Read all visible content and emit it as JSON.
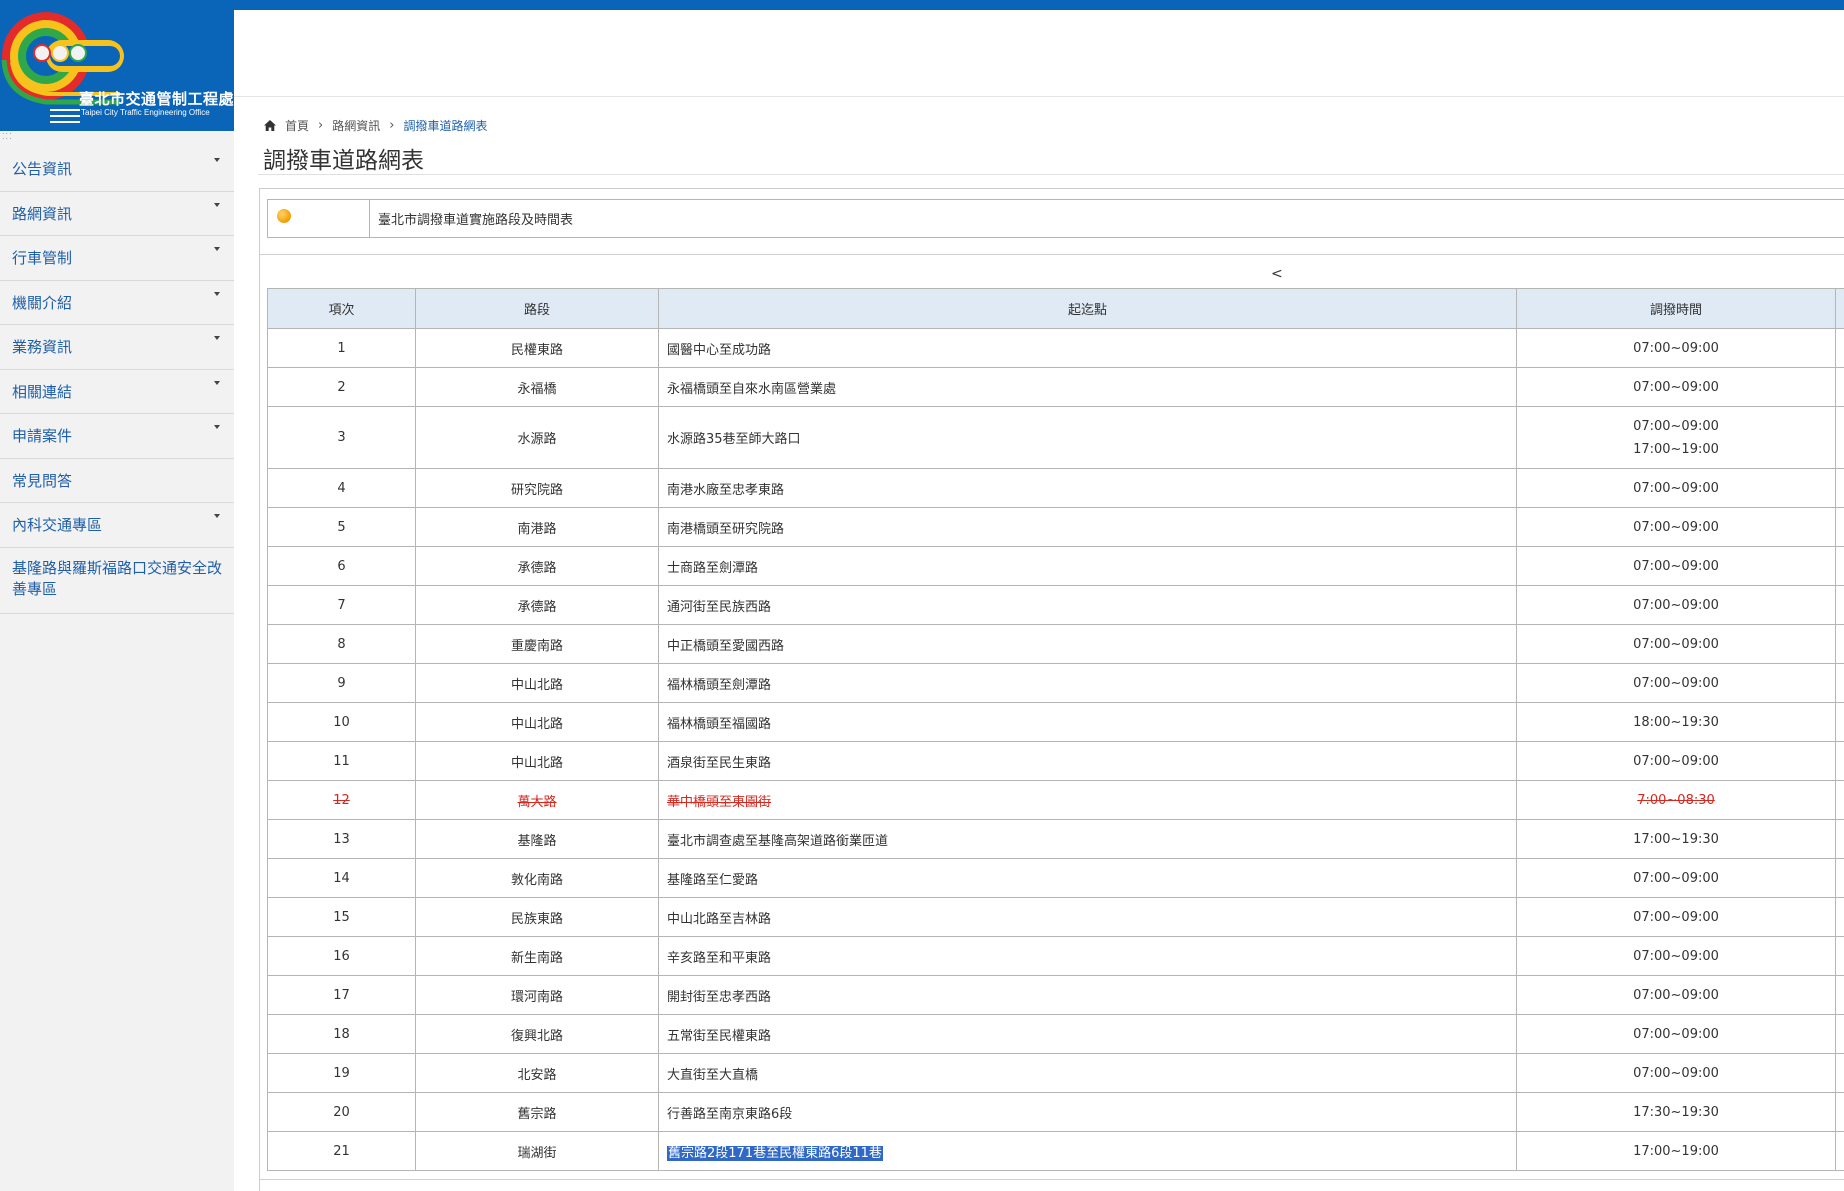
{
  "logo": {
    "title": "臺北市交通管制工程處",
    "subtitle": "Taipei City Traffic Engineering Office"
  },
  "sidebar": {
    "items": [
      {
        "label": "公告資訊",
        "has_submenu": true
      },
      {
        "label": "路網資訊",
        "has_submenu": true
      },
      {
        "label": "行車管制",
        "has_submenu": true
      },
      {
        "label": "機關介紹",
        "has_submenu": true
      },
      {
        "label": "業務資訊",
        "has_submenu": true
      },
      {
        "label": "相關連結",
        "has_submenu": true
      },
      {
        "label": "申請案件",
        "has_submenu": true
      },
      {
        "label": "常見問答",
        "has_submenu": false
      },
      {
        "label": "內科交通專區",
        "has_submenu": true
      },
      {
        "label": "基隆路與羅斯福路口交通安全改善專區",
        "has_submenu": false
      }
    ]
  },
  "breadcrumb": {
    "home": "首頁",
    "level1": "路網資訊",
    "current": "調撥車道路網表"
  },
  "page": {
    "title": "調撥車道路網表",
    "caption": "臺北市調撥車道實施路段及時間表",
    "prev_arrow": "<"
  },
  "table": {
    "headers": [
      "項次",
      "路段",
      "起迄點",
      "調撥時間"
    ],
    "rows": [
      {
        "no": "1",
        "road": "民權東路",
        "range": "國醫中心至成功路",
        "time": "07:00~09:00"
      },
      {
        "no": "2",
        "road": "永福橋",
        "range": "永福橋頭至自來水南區營業處",
        "time": "07:00~09:00"
      },
      {
        "no": "3",
        "road": "水源路",
        "range": "水源路35巷至師大路口",
        "time": "07:00~09:00",
        "time2": "17:00~19:00"
      },
      {
        "no": "4",
        "road": "研究院路",
        "range": "南港水廠至忠孝東路",
        "time": "07:00~09:00"
      },
      {
        "no": "5",
        "road": "南港路",
        "range": "南港橋頭至研究院路",
        "time": "07:00~09:00"
      },
      {
        "no": "6",
        "road": "承德路",
        "range": "士商路至劍潭路",
        "time": "07:00~09:00"
      },
      {
        "no": "7",
        "road": "承德路",
        "range": "通河街至民族西路",
        "time": "07:00~09:00"
      },
      {
        "no": "8",
        "road": "重慶南路",
        "range": "中正橋頭至愛國西路",
        "time": "07:00~09:00"
      },
      {
        "no": "9",
        "road": "中山北路",
        "range": "福林橋頭至劍潭路",
        "time": "07:00~09:00"
      },
      {
        "no": "10",
        "road": "中山北路",
        "range": "福林橋頭至福國路",
        "time": "18:00~19:30"
      },
      {
        "no": "11",
        "road": "中山北路",
        "range": "酒泉街至民生東路",
        "time": "07:00~09:00"
      },
      {
        "no": "12",
        "road": "萬大路",
        "range": "華中橋頭至東園街",
        "time": "7:00~08:30",
        "struck": true
      },
      {
        "no": "13",
        "road": "基隆路",
        "range": "臺北市調查處至基隆高架道路銜業匝道",
        "time": "17:00~19:30"
      },
      {
        "no": "14",
        "road": "敦化南路",
        "range": "基隆路至仁愛路",
        "time": "07:00~09:00"
      },
      {
        "no": "15",
        "road": "民族東路",
        "range": "中山北路至吉林路",
        "time": "07:00~09:00"
      },
      {
        "no": "16",
        "road": "新生南路",
        "range": "辛亥路至和平東路",
        "time": "07:00~09:00"
      },
      {
        "no": "17",
        "road": "環河南路",
        "range": "開封街至忠孝西路",
        "time": "07:00~09:00"
      },
      {
        "no": "18",
        "road": "復興北路",
        "range": "五常街至民權東路",
        "time": "07:00~09:00"
      },
      {
        "no": "19",
        "road": "北安路",
        "range": "大直街至大直橋",
        "time": "07:00~09:00"
      },
      {
        "no": "20",
        "road": "舊宗路",
        "range": "行善路至南京東路6段",
        "time": "17:30~19:30"
      },
      {
        "no": "21",
        "road": "瑞湖街",
        "range": "舊宗路2段171巷至民權東路6段11巷",
        "time": "17:00~19:00",
        "selected": true
      }
    ]
  },
  "colors": {
    "brand_blue": "#0a64b7",
    "link_blue": "#1f5fa8",
    "header_cell": "#dfeaf5",
    "struck_red": "#d4291f",
    "selection": "#2f68c6"
  }
}
